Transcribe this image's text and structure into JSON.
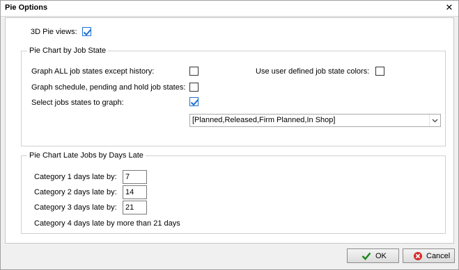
{
  "window": {
    "title": "Pie Options"
  },
  "options": {
    "pie3d_label": "3D Pie views:",
    "pie3d_checked": true
  },
  "job_state_group": {
    "legend": "Pie Chart by Job State",
    "graph_all_label": "Graph ALL  job states except history:",
    "graph_all_checked": false,
    "graph_sched_label": "Graph schedule, pending and hold job states:",
    "graph_sched_checked": false,
    "select_states_label": "Select jobs states to graph:",
    "select_states_checked": true,
    "user_colors_label": "Use user defined job state colors:",
    "user_colors_checked": false,
    "states_value": "[Planned,Released,Firm Planned,In Shop]"
  },
  "late_group": {
    "legend": "Pie Chart Late Jobs by Days Late",
    "cat1_label": "Category 1 days late by:",
    "cat1_value": "7",
    "cat2_label": "Category 2 days late by:",
    "cat2_value": "14",
    "cat3_label": "Category 3 days late by:",
    "cat3_value": "21",
    "cat4_text": "Category 4 days late by more than 21 days"
  },
  "buttons": {
    "ok_label": "OK",
    "cancel_label": "Cancel"
  }
}
